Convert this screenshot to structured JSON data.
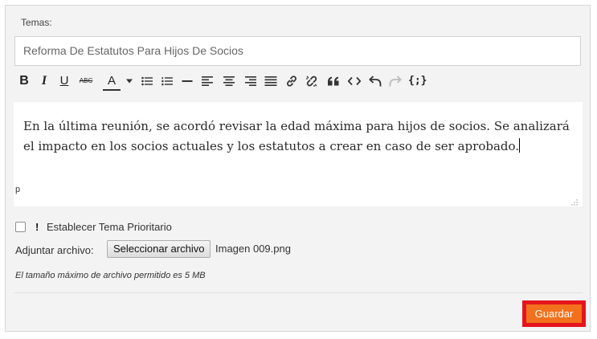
{
  "form": {
    "temas_label": "Temas:",
    "subject_value": "Reforma De Estatutos Para Hijos De Socios",
    "toolbar": [
      {
        "name": "bold-button",
        "glyph": "B",
        "label": "bold"
      },
      {
        "name": "italic-button",
        "glyph": "I",
        "label": "italic"
      },
      {
        "name": "underline-button",
        "glyph": "U",
        "label": "underline"
      },
      {
        "name": "strikethrough-button",
        "glyph": "ABC",
        "label": "strikethrough"
      },
      {
        "name": "text-color-button",
        "glyph": "A",
        "label": "text color"
      },
      {
        "name": "bullet-list-button",
        "label": "bullet list"
      },
      {
        "name": "numbered-list-button",
        "label": "numbered list"
      },
      {
        "name": "horizontal-rule-button",
        "label": "horizontal rule"
      },
      {
        "name": "align-left-button",
        "label": "align left"
      },
      {
        "name": "align-center-button",
        "label": "align center"
      },
      {
        "name": "align-right-button",
        "label": "align right"
      },
      {
        "name": "justify-button",
        "label": "justify"
      },
      {
        "name": "link-button",
        "label": "link"
      },
      {
        "name": "unlink-button",
        "label": "unlink"
      },
      {
        "name": "blockquote-button",
        "label": "blockquote"
      },
      {
        "name": "code-button",
        "label": "code"
      },
      {
        "name": "undo-button",
        "label": "undo"
      },
      {
        "name": "redo-button",
        "label": "redo"
      },
      {
        "name": "source-code-button",
        "glyph": "{;}",
        "label": "source code"
      }
    ],
    "editor_text": "En la última reunión, se acordó revisar la edad máxima para hijos de socios. Se analizará el impacto en los socios actuales y los estatutos a crear en caso de ser aprobado.",
    "editor_path": "p",
    "priority_label": "Establecer Tema Prioritario",
    "priority_icon": "!",
    "priority_checked": false,
    "attach_label": "Adjuntar archivo:",
    "choose_file_button": "Seleccionar archivo",
    "file_name": "Imagen 009.png",
    "max_size_note": "El tamaño máximo de archivo permitido es 5 MB",
    "save_button": "Guardar"
  },
  "colors": {
    "save_bg": "#f2711c",
    "save_border": "#e5141c",
    "panel_bg": "#f3f3f3"
  }
}
